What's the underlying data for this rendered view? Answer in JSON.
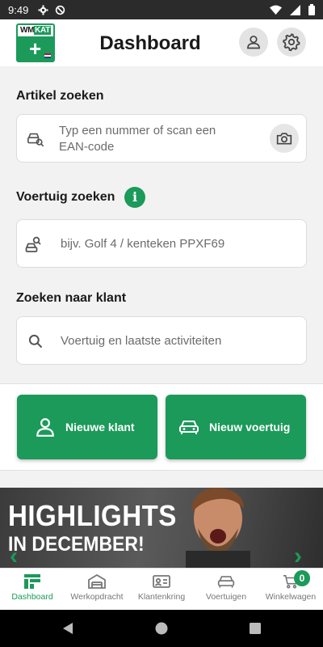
{
  "status_bar": {
    "time": "9:49"
  },
  "header": {
    "logo_text_a": "WM",
    "logo_text_b": "KAT",
    "title": "Dashboard"
  },
  "search_article": {
    "label": "Artikel zoeken",
    "placeholder_line1": "Typ een nummer of scan een",
    "placeholder_line2": "EAN-code"
  },
  "search_vehicle": {
    "label": "Voertuig zoeken",
    "info": "i",
    "placeholder": "bijv. Golf 4 / kenteken PPXF69"
  },
  "search_customer": {
    "label": "Zoeken naar klant",
    "placeholder": "Voertuig en laatste activiteiten"
  },
  "actions": {
    "new_customer": "Nieuwe klant",
    "new_vehicle": "Nieuw voertuig"
  },
  "banner": {
    "line1": "HIGHLIGHTS",
    "line2": "IN DECEMBER!"
  },
  "tabs": [
    {
      "label": "Dashboard",
      "icon": "dashboard-icon",
      "active": true
    },
    {
      "label": "Werkopdracht",
      "icon": "garage-icon"
    },
    {
      "label": "Klantenkring",
      "icon": "contact-card-icon"
    },
    {
      "label": "Voertuigen",
      "icon": "car-icon"
    },
    {
      "label": "Winkelwagen",
      "icon": "cart-icon",
      "badge": "0"
    }
  ],
  "colors": {
    "accent": "#1b9a5a",
    "status_bar": "#2b2b2b",
    "background": "#f2f2f2"
  }
}
